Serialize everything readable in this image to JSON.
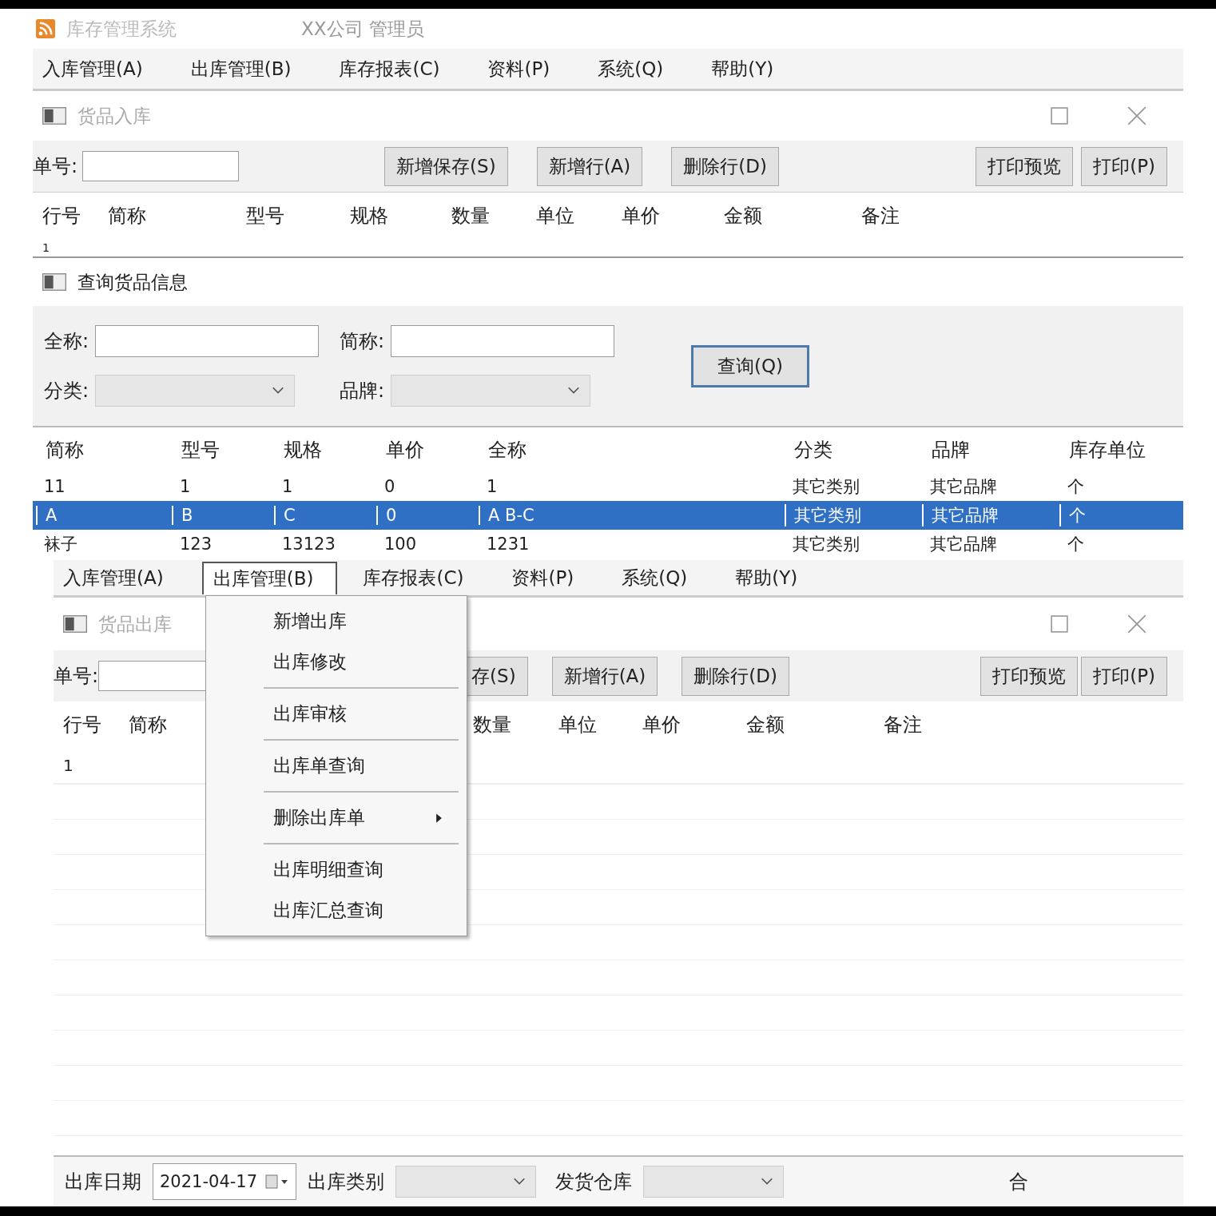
{
  "app": {
    "title": "库存管理系统",
    "user": "XX公司 管理员"
  },
  "menu_bar": [
    {
      "label": "入库管理(A)",
      "selected": false
    },
    {
      "label": "出库管理(B)",
      "selected": false
    },
    {
      "label": "库存报表(C)",
      "selected": false
    },
    {
      "label": "资料(P)",
      "selected": false
    },
    {
      "label": "系统(Q)",
      "selected": false
    },
    {
      "label": "帮助(Y)",
      "selected": false
    }
  ],
  "inbound_window": {
    "title": "货品入库",
    "order_label": "单号:",
    "buttons": [
      "新增保存(S)",
      "新增行(A)",
      "删除行(D)",
      "打印预览",
      "打印(P)"
    ],
    "columns": [
      "行号",
      "简称",
      "型号",
      "规格",
      "数量",
      "单位",
      "单价",
      "金额",
      "备注"
    ],
    "rows": [
      [
        "1"
      ]
    ]
  },
  "query_window": {
    "title": "查询货品信息",
    "fields": [
      {
        "label": "全称:",
        "kind": "text"
      },
      {
        "label": "简称:",
        "kind": "text"
      },
      {
        "label": "分类:",
        "kind": "select"
      },
      {
        "label": "品牌:",
        "kind": "select"
      }
    ],
    "button": "查询(Q)",
    "columns": [
      "简称",
      "型号",
      "规格",
      "单价",
      "全称",
      "分类",
      "品牌",
      "库存单位"
    ],
    "rows": [
      {
        "cells": [
          "11",
          "1",
          "1",
          "0",
          "1",
          "其它类别",
          "其它品牌",
          "个"
        ],
        "selected": false
      },
      {
        "cells": [
          "A",
          "B",
          "C",
          "0",
          "A B-C",
          "其它类别",
          "其它品牌",
          "个"
        ],
        "selected": true
      },
      {
        "cells": [
          "袜子",
          "123",
          "13123",
          "100",
          "1231",
          "其它类别",
          "其它品牌",
          "个"
        ],
        "selected": false
      }
    ]
  },
  "menu_bar_2": [
    {
      "label": "入库管理(A)",
      "selected": false
    },
    {
      "label": "出库管理(B)",
      "selected": true
    },
    {
      "label": "库存报表(C)",
      "selected": false
    },
    {
      "label": "资料(P)",
      "selected": false
    },
    {
      "label": "系统(Q)",
      "selected": false
    },
    {
      "label": "帮助(Y)",
      "selected": false
    }
  ],
  "dropdown": {
    "groups": [
      [
        {
          "label": "新增出库",
          "has_submenu": false
        },
        {
          "label": "出库修改",
          "has_submenu": false
        }
      ],
      [
        {
          "label": "出库审核",
          "has_submenu": false
        }
      ],
      [
        {
          "label": "出库单查询",
          "has_submenu": false
        }
      ],
      [
        {
          "label": "删除出库单",
          "has_submenu": true
        }
      ],
      [
        {
          "label": "出库明细查询",
          "has_submenu": false
        },
        {
          "label": "出库汇总查询",
          "has_submenu": false
        }
      ]
    ]
  },
  "outbound_window": {
    "title": "货品出库",
    "order_label": "单号:",
    "buttons": [
      "存(S)",
      "新增行(A)",
      "删除行(D)",
      "打印预览",
      "打印(P)"
    ],
    "columns": [
      "行号",
      "简称",
      "数量",
      "单位",
      "单价",
      "金额",
      "备注"
    ],
    "rows": [
      [
        "1"
      ]
    ],
    "footer": {
      "date_label": "出库日期",
      "date": "2021-04-17",
      "type_label": "出库类别",
      "warehouse_label": "发货仓库",
      "total_label": "合"
    }
  }
}
